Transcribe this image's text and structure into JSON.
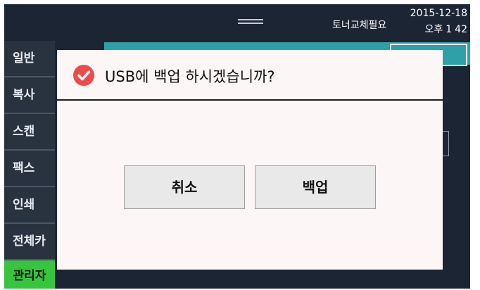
{
  "status": {
    "message": "토너교체필요",
    "date": "2015-12-18",
    "ampm": "오후",
    "hour": "1",
    "minute": "42"
  },
  "sidebar": {
    "items": [
      {
        "label": "일반"
      },
      {
        "label": "복사"
      },
      {
        "label": "스캔"
      },
      {
        "label": "팩스"
      },
      {
        "label": "인쇄"
      },
      {
        "label": "전체카"
      },
      {
        "label": "관리자",
        "active": true
      }
    ]
  },
  "dialog": {
    "title": "USB에 백업 하시겠습니까?",
    "cancel_label": "취소",
    "confirm_label": "백업",
    "icon": "check-circle-icon"
  },
  "colors": {
    "screen_bg": "#1c2533",
    "accent_green": "#37c43f",
    "header_teal": "#2fa0a8",
    "icon_red": "#ef4a4a"
  }
}
